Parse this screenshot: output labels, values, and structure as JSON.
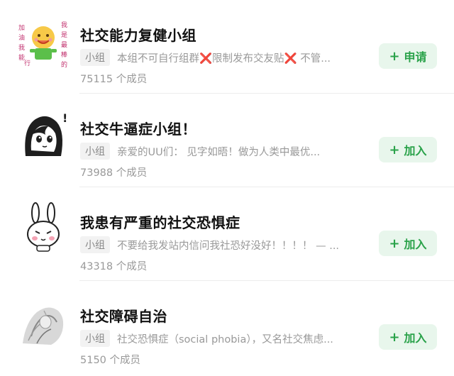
{
  "groups": [
    {
      "title": "社交能力复健小组",
      "tag": "小组",
      "description": "本组不可自行组群❌限制发布交友贴❌ 不管...",
      "members": "75115 个成员",
      "button": "+ 申请",
      "button_plus": "+",
      "button_text": "申请",
      "avatar_icon": "smiley-badge-icon",
      "avatar_left": "加油我能行",
      "avatar_right": "我是最棒的"
    },
    {
      "title": "社交牛逼症小组！",
      "tag": "小组",
      "description": "亲爱的UU们：  见字如晤！做为人类中最优...",
      "members": "73988 个成员",
      "button_plus": "+",
      "button_text": "加入",
      "avatar_icon": "anime-girl-icon"
    },
    {
      "title": "我患有严重的社交恐惧症",
      "tag": "小组",
      "description": "不要给我发站内信问我社恐好没好！！！！ — ...",
      "members": "43318 个成员",
      "button_plus": "+",
      "button_text": "加入",
      "avatar_icon": "rabbit-icon"
    },
    {
      "title": "社交障碍自治",
      "tag": "小组",
      "description": "社交恐惧症（social phobia），又名社交焦虑...",
      "members": "5150 个成员",
      "button_plus": "+",
      "button_text": "加入",
      "avatar_icon": "sketch-figure-icon"
    }
  ],
  "colors": {
    "accent": "#2aa24a",
    "button_bg": "#e8f6ec",
    "muted_text": "#999999"
  }
}
